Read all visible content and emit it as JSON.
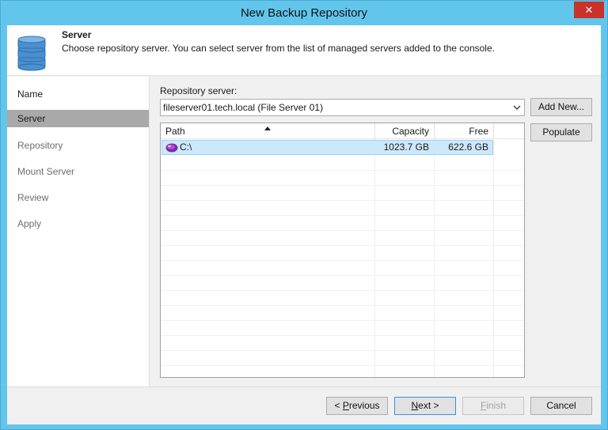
{
  "window": {
    "title": "New Backup Repository",
    "close_glyph": "✕"
  },
  "header": {
    "icon": "database-icon",
    "title": "Server",
    "description": "Choose repository server. You can select server from the list of managed servers added to the console."
  },
  "steps": [
    {
      "label": "Name",
      "state": "done"
    },
    {
      "label": "Server",
      "state": "active"
    },
    {
      "label": "Repository",
      "state": "todo"
    },
    {
      "label": "Mount Server",
      "state": "todo"
    },
    {
      "label": "Review",
      "state": "todo"
    },
    {
      "label": "Apply",
      "state": "todo"
    }
  ],
  "repository_server": {
    "label": "Repository server:",
    "selected": "fileserver01.tech.local (File Server 01)"
  },
  "side_buttons": {
    "add_new": "Add New...",
    "populate": "Populate"
  },
  "table": {
    "columns": [
      "Path",
      "Capacity",
      "Free"
    ],
    "sorted_column": "Path",
    "rows": [
      {
        "path": "C:\\",
        "capacity": "1023.7 GB",
        "free": "622.6 GB"
      }
    ]
  },
  "footer": {
    "prev_prefix": "< ",
    "prev_key": "P",
    "prev_rest": "revious",
    "next_key": "N",
    "next_rest": "ext >",
    "finish_key": "F",
    "finish_rest": "inish",
    "cancel": "Cancel"
  },
  "colors": {
    "frame": "#62c6ec",
    "selection": "#cde8fb",
    "active_step": "#a9a9a9"
  }
}
